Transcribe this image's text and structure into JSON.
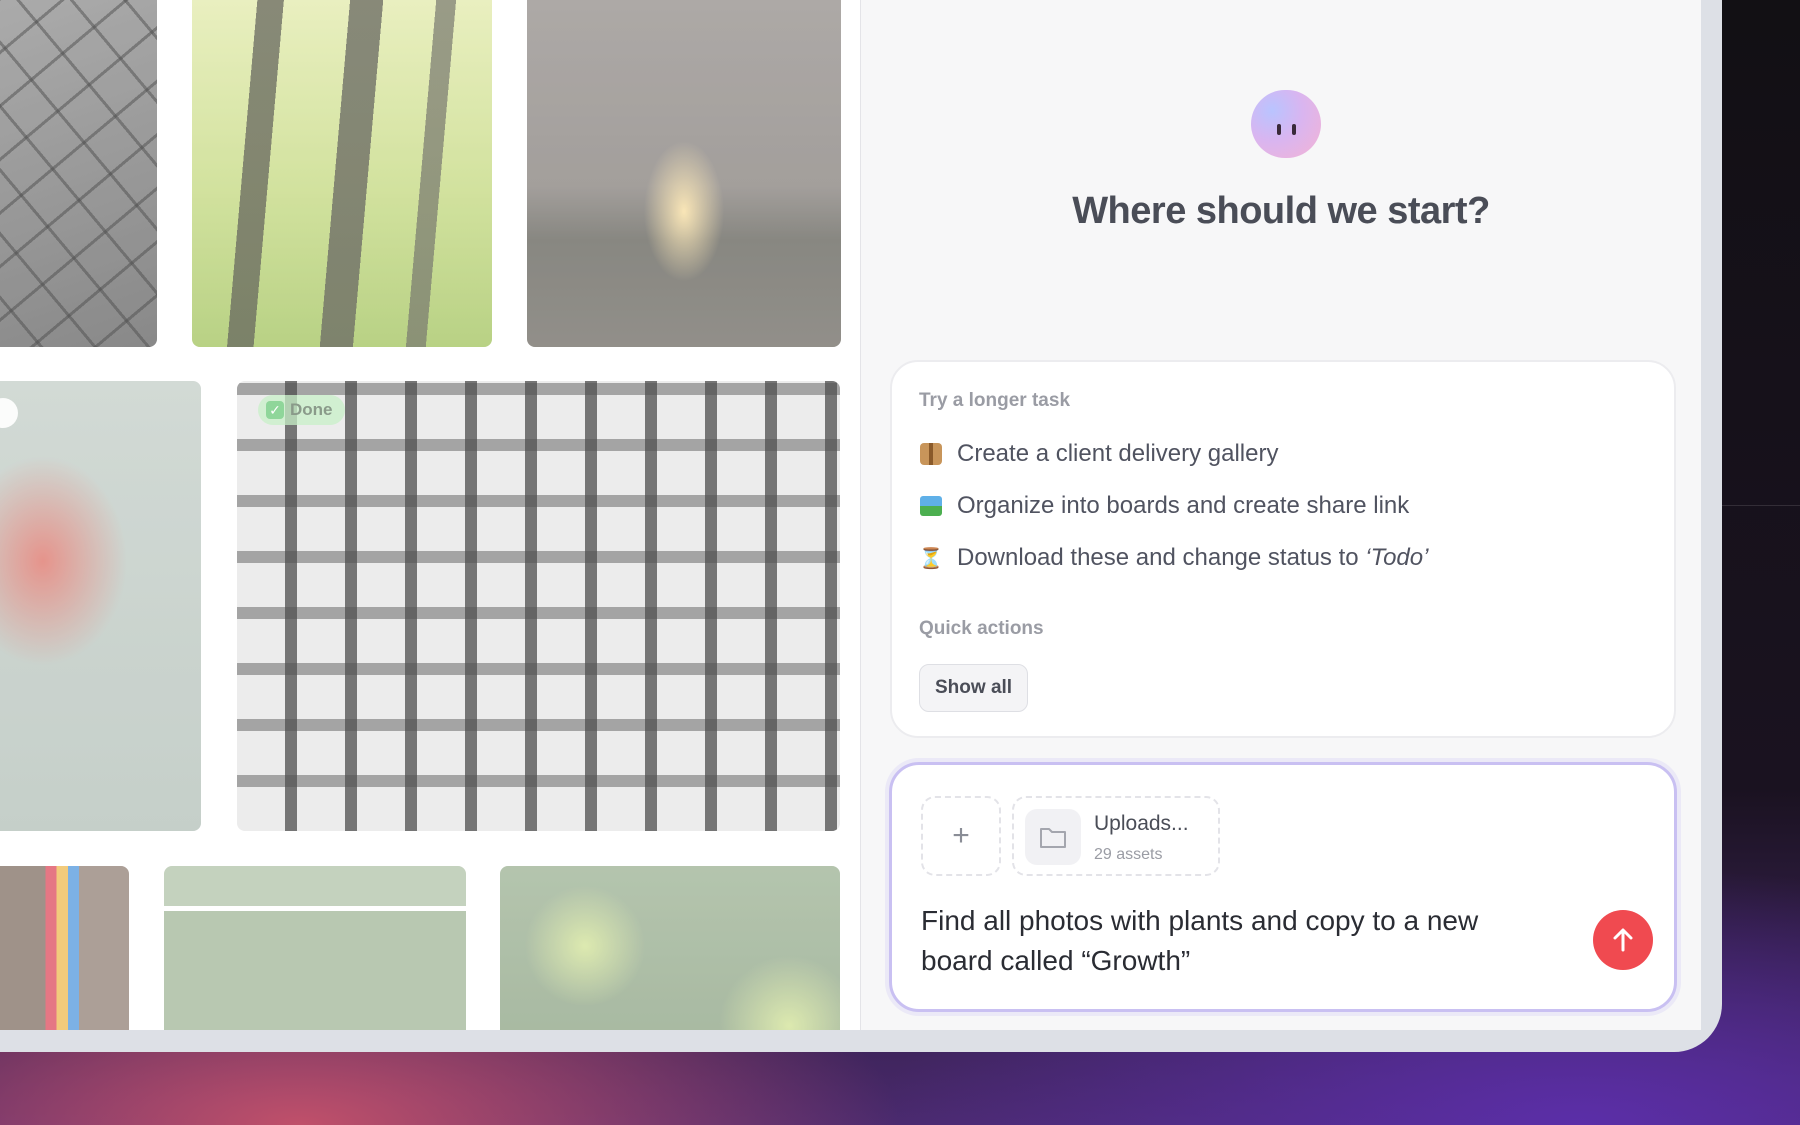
{
  "gallery": {
    "done_badge": "Done"
  },
  "assistant": {
    "heading": "Where should we start?",
    "longer_task_label": "Try a longer task",
    "tasks": [
      {
        "icon": "package-icon",
        "label": "Create a client delivery gallery"
      },
      {
        "icon": "picture-icon",
        "label": "Organize into boards and create share link"
      },
      {
        "icon": "hourglass-icon",
        "label_prefix": "Download these and change status to ",
        "label_quote": "‘Todo’"
      }
    ],
    "quick_actions_label": "Quick actions",
    "show_all": "Show all"
  },
  "composer": {
    "attachment_title": "Uploads...",
    "attachment_count": "29 assets",
    "prompt": "Find all photos with plants and copy to a new board called “Growth”"
  },
  "colors": {
    "accent_send": "#f04a50",
    "composer_border": "#c9c0f2"
  }
}
